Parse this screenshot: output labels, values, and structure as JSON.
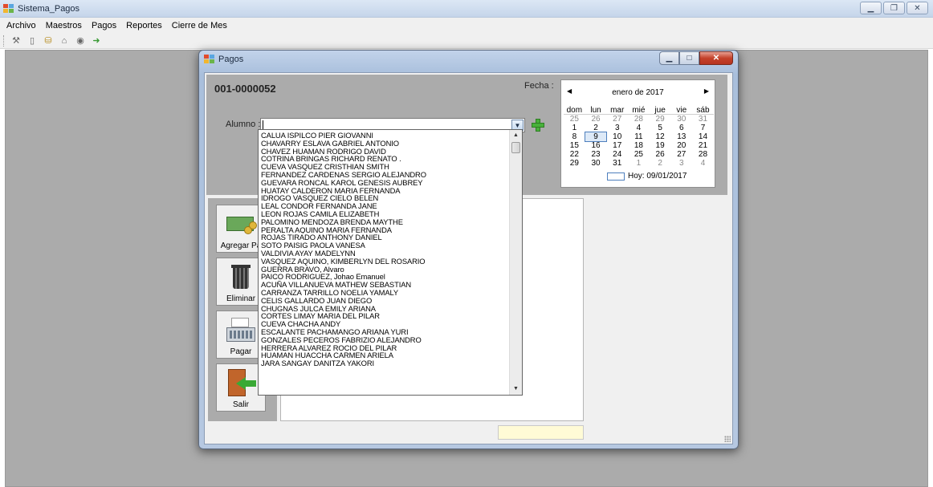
{
  "window": {
    "title": "Sistema_Pagos"
  },
  "menu": {
    "items": [
      "Archivo",
      "Maestros",
      "Pagos",
      "Reportes",
      "Cierre de Mes"
    ]
  },
  "toolbar": {
    "icons": [
      "tools-icon",
      "document-icon",
      "coins-icon",
      "lock-icon",
      "eye-icon",
      "exit-icon"
    ]
  },
  "dialog": {
    "title": "Pagos",
    "doc_number": "001-0000052",
    "fecha_label": "Fecha :",
    "alumno_label": "Alumno :",
    "alumno_value": ""
  },
  "calendar": {
    "month_label": "enero de 2017",
    "weekdays": [
      "dom",
      "lun",
      "mar",
      "mié",
      "jue",
      "vie",
      "sáb"
    ],
    "weeks": [
      [
        "25",
        "26",
        "27",
        "28",
        "29",
        "30",
        "31"
      ],
      [
        "1",
        "2",
        "3",
        "4",
        "5",
        "6",
        "7"
      ],
      [
        "8",
        "9",
        "10",
        "11",
        "12",
        "13",
        "14"
      ],
      [
        "15",
        "16",
        "17",
        "18",
        "19",
        "20",
        "21"
      ],
      [
        "22",
        "23",
        "24",
        "25",
        "26",
        "27",
        "28"
      ],
      [
        "29",
        "30",
        "31",
        "1",
        "2",
        "3",
        "4"
      ]
    ],
    "selected_day": "9",
    "today_label": "Hoy: 09/01/2017"
  },
  "actions": {
    "agregar": "Agregar Pa",
    "eliminar": "Eliminar",
    "pagar": "Pagar",
    "salir": "Salir"
  },
  "students": [
    "CALUA ISPILCO PIER GIOVANNI",
    "CHAVARRY ESLAVA GABRIEL ANTONIO",
    "CHAVEZ HUAMAN RODRIGO DAVID",
    "COTRINA BRINGAS RICHARD RENATO .",
    "CUEVA VASQUEZ CRISTHIAN SMITH",
    "FERNANDEZ CARDENAS SERGIO ALEJANDRO",
    "GUEVARA RONCAL KAROL GENESIS AUBREY",
    "HUATAY CALDERON MARIA FERNANDA",
    "IDROGO VASQUEZ CIELO BELEN",
    "LEAL CONDOR FERNANDA JANE",
    "LEON ROJAS CAMILA ELIZABETH",
    "PALOMINO MENDOZA BRENDA MAYTHE",
    "PERALTA AQUINO MARIA FERNANDA",
    "ROJAS TIRADO ANTHONY DANIEL",
    "SOTO PAISIG PAOLA VANESA",
    "VALDIVIA AYAY MADELYNN",
    "VASQUEZ AQUINO, KIMBERLYN DEL ROSARIO",
    "GUERRA BRAVO, Alvaro",
    "PAICO RODRIGUEZ, Johao Emanuel",
    "ACUÑA VILLANUEVA MATHEW SEBASTIAN",
    "CARRANZA TARRILLO NOELIA YAMALY",
    "CELIS GALLARDO JUAN DIEGO",
    "CHUGNAS JULCA EMILY ARIANA",
    "CORTES LIMAY MARIA DEL PILAR",
    "CUEVA CHACHA ANDY",
    "ESCALANTE PACHAMANGO ARIANA YURI",
    "GONZALES PECEROS FABRIZIO ALEJANDRO",
    "HERRERA ALVAREZ ROCIO DEL PILAR",
    "HUAMAN HUACCHA CARMEN ARIELA",
    "JARA SANGAY DANITZA YAKORI"
  ]
}
